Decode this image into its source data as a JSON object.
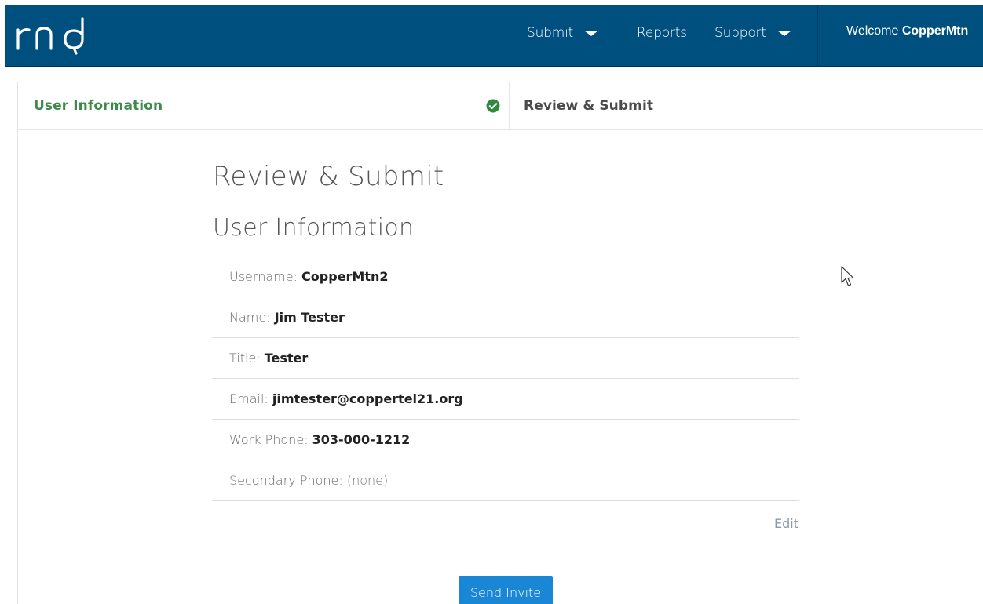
{
  "brand": {
    "logo_text": "rnd"
  },
  "nav": {
    "items": [
      {
        "label": "Submit",
        "has_dropdown": true
      },
      {
        "label": "Reports",
        "has_dropdown": false
      },
      {
        "label": "Support",
        "has_dropdown": true
      }
    ],
    "welcome_prefix": "Welcome",
    "welcome_user": "CopperMtn"
  },
  "wizard": {
    "steps": [
      {
        "label": "User Information",
        "status": "complete",
        "icon": "check-circle-icon"
      },
      {
        "label": "Review & Submit",
        "status": "current"
      }
    ]
  },
  "main": {
    "page_title": "Review & Submit",
    "section_title": "User Information",
    "fields": [
      {
        "label": "Username: ",
        "value": "CopperMtn2"
      },
      {
        "label": "Name: ",
        "value": "Jim Tester"
      },
      {
        "label": "Title: ",
        "value": "Tester"
      },
      {
        "label": "Email: ",
        "value": "jimtester@coppertel21.org"
      },
      {
        "label": "Work Phone: ",
        "value": "303-000-1212"
      },
      {
        "label": "Secondary Phone: ",
        "value": "(none)"
      }
    ],
    "edit_label": "Edit",
    "send_invite_label": "Send Invite"
  },
  "colors": {
    "header_bg": "#00507f",
    "step_complete": "#3e8a4a",
    "check_green": "#2f8a3e",
    "primary_button": "#1a86d6"
  }
}
